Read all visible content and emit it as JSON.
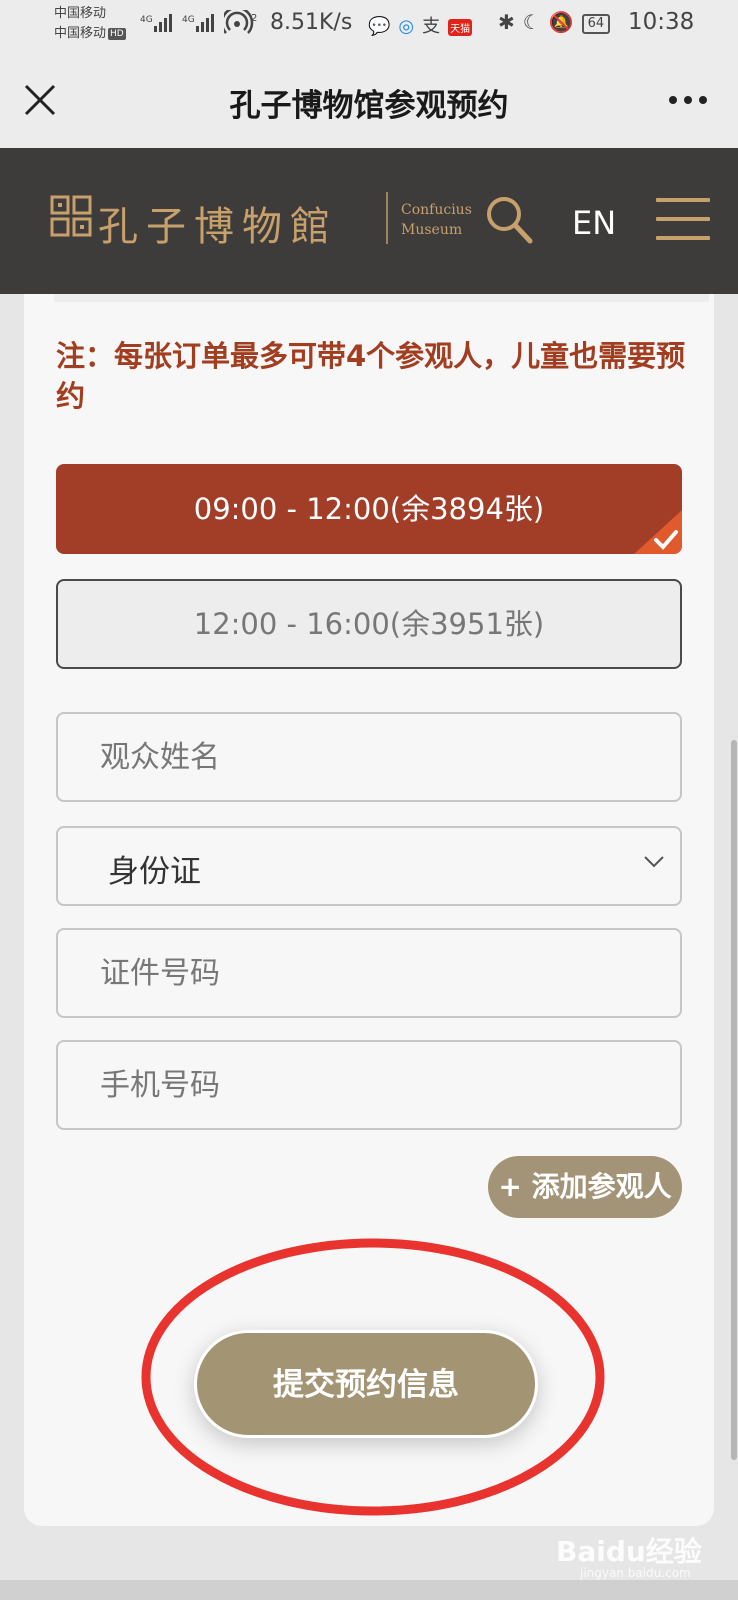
{
  "status_bar": {
    "carrier1": "中国移动",
    "carrier2": "中国移动",
    "hd": "HD",
    "net_speed": "8.51K/s",
    "tmall_badge": "天猫",
    "battery": "64",
    "time": "10:38"
  },
  "titlebar": {
    "title": "孔子博物馆参观预约"
  },
  "museum_header": {
    "logo_cn": "孔子博物館",
    "logo_en_line1": "Confucius",
    "logo_en_line2": "Museum",
    "lang": "EN"
  },
  "form": {
    "note": "注：每张订单最多可带4个参观人，儿童也需要预约",
    "slots": [
      {
        "label": "09:00 - 12:00(余3894张)",
        "selected": true
      },
      {
        "label": "12:00 - 16:00(余3951张)",
        "selected": false
      }
    ],
    "name_placeholder": "观众姓名",
    "id_type_value": "身份证",
    "id_number_placeholder": "证件号码",
    "phone_placeholder": "手机号码",
    "add_visitor_label": "+ 添加参观人",
    "submit_label": "提交预约信息"
  },
  "colors": {
    "accent_red": "#a23d27",
    "gold": "#c7a06b",
    "button_tan": "#a39573",
    "header_dark": "#3d3c3a",
    "annotation_red": "#e8332e"
  },
  "watermark": {
    "main": "Baidu经验",
    "sub": "jingyan.baidu.com"
  }
}
